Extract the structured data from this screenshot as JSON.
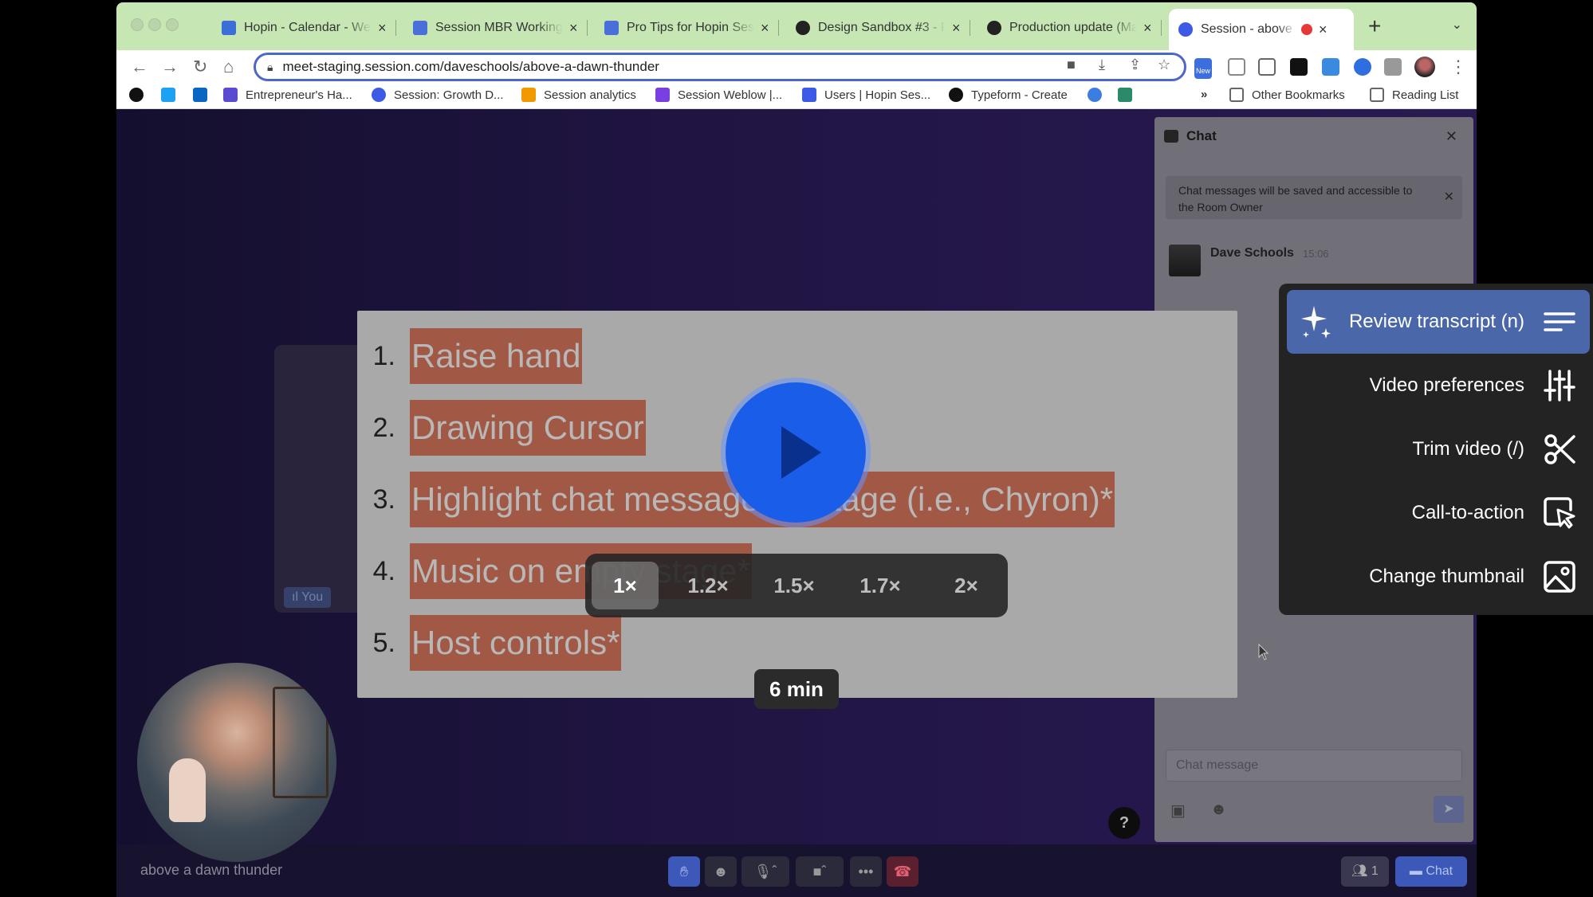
{
  "browser": {
    "tabs": [
      {
        "title": "Hopin - Calendar - Wee",
        "favicon_color": "#3b6fd8"
      },
      {
        "title": "Session MBR Working",
        "favicon_color": "#4a6fd8"
      },
      {
        "title": "Pro Tips for Hopin Sess",
        "favicon_color": "#4a6fd8"
      },
      {
        "title": "Design Sandbox #3 - P",
        "favicon_color": "#222222"
      },
      {
        "title": "Production update (Ma",
        "favicon_color": "#222222"
      },
      {
        "title": "Session - above a",
        "favicon_color": "#3d5ae6"
      }
    ],
    "url": "meet-staging.session.com/daveschools/above-a-dawn-thunder",
    "new_badge": "New",
    "bookmarks": [
      {
        "label": "",
        "color": "#111111"
      },
      {
        "label": "",
        "color": "#1da1f2"
      },
      {
        "label": "",
        "color": "#0a66c2"
      },
      {
        "label": "Entrepreneur's Ha...",
        "color": "#5a4bd1"
      },
      {
        "label": "Session: Growth D...",
        "color": "#3d5ae6"
      },
      {
        "label": "Session analytics",
        "color": "#f29900"
      },
      {
        "label": "Session Weblow |...",
        "color": "#7a3fe0"
      },
      {
        "label": "Users | Hopin Ses...",
        "color": "#3d5ae6"
      },
      {
        "label": "Typeform - Create",
        "color": "#111111"
      },
      {
        "label": "",
        "color": "#3b7de0"
      },
      {
        "label": "",
        "color": "#2a8a6a"
      }
    ],
    "overflow": "»",
    "other_bookmarks": "Other Bookmarks",
    "reading_list": "Reading List"
  },
  "chat": {
    "title": "Chat",
    "notice": "Chat messages will be saved and accessible to the Room Owner",
    "message": {
      "author": "Dave Schools",
      "time": "15:06"
    },
    "input_placeholder": "Chat message"
  },
  "stage": {
    "you_label": "You",
    "slide_items": [
      {
        "num": "1.",
        "text": "Raise hand"
      },
      {
        "num": "2.",
        "text": "Drawing Cursor"
      },
      {
        "num": "3.",
        "text": "Highlight chat message on stage (i.e., Chyron)*"
      },
      {
        "num": "4.",
        "text": "Music on empty stage*"
      },
      {
        "num": "5.",
        "text": "Host controls*"
      }
    ]
  },
  "bottom_bar": {
    "room_name": "above a dawn thunder",
    "people_count": "1",
    "chat_label": "Chat",
    "help": "?"
  },
  "player": {
    "speeds": [
      "1×",
      "1.2×",
      "1.5×",
      "1.7×",
      "2×"
    ],
    "selected_speed": "1×",
    "duration": "6 min"
  },
  "menu": {
    "items": [
      {
        "label": "Review transcript (n)",
        "icon": "transcript-icon"
      },
      {
        "label": "Video preferences",
        "icon": "sliders-icon"
      },
      {
        "label": "Trim video (/)",
        "icon": "scissors-icon"
      },
      {
        "label": "Call-to-action",
        "icon": "cursor-click-icon"
      },
      {
        "label": "Change thumbnail",
        "icon": "image-icon"
      }
    ],
    "selected_index": 0
  }
}
